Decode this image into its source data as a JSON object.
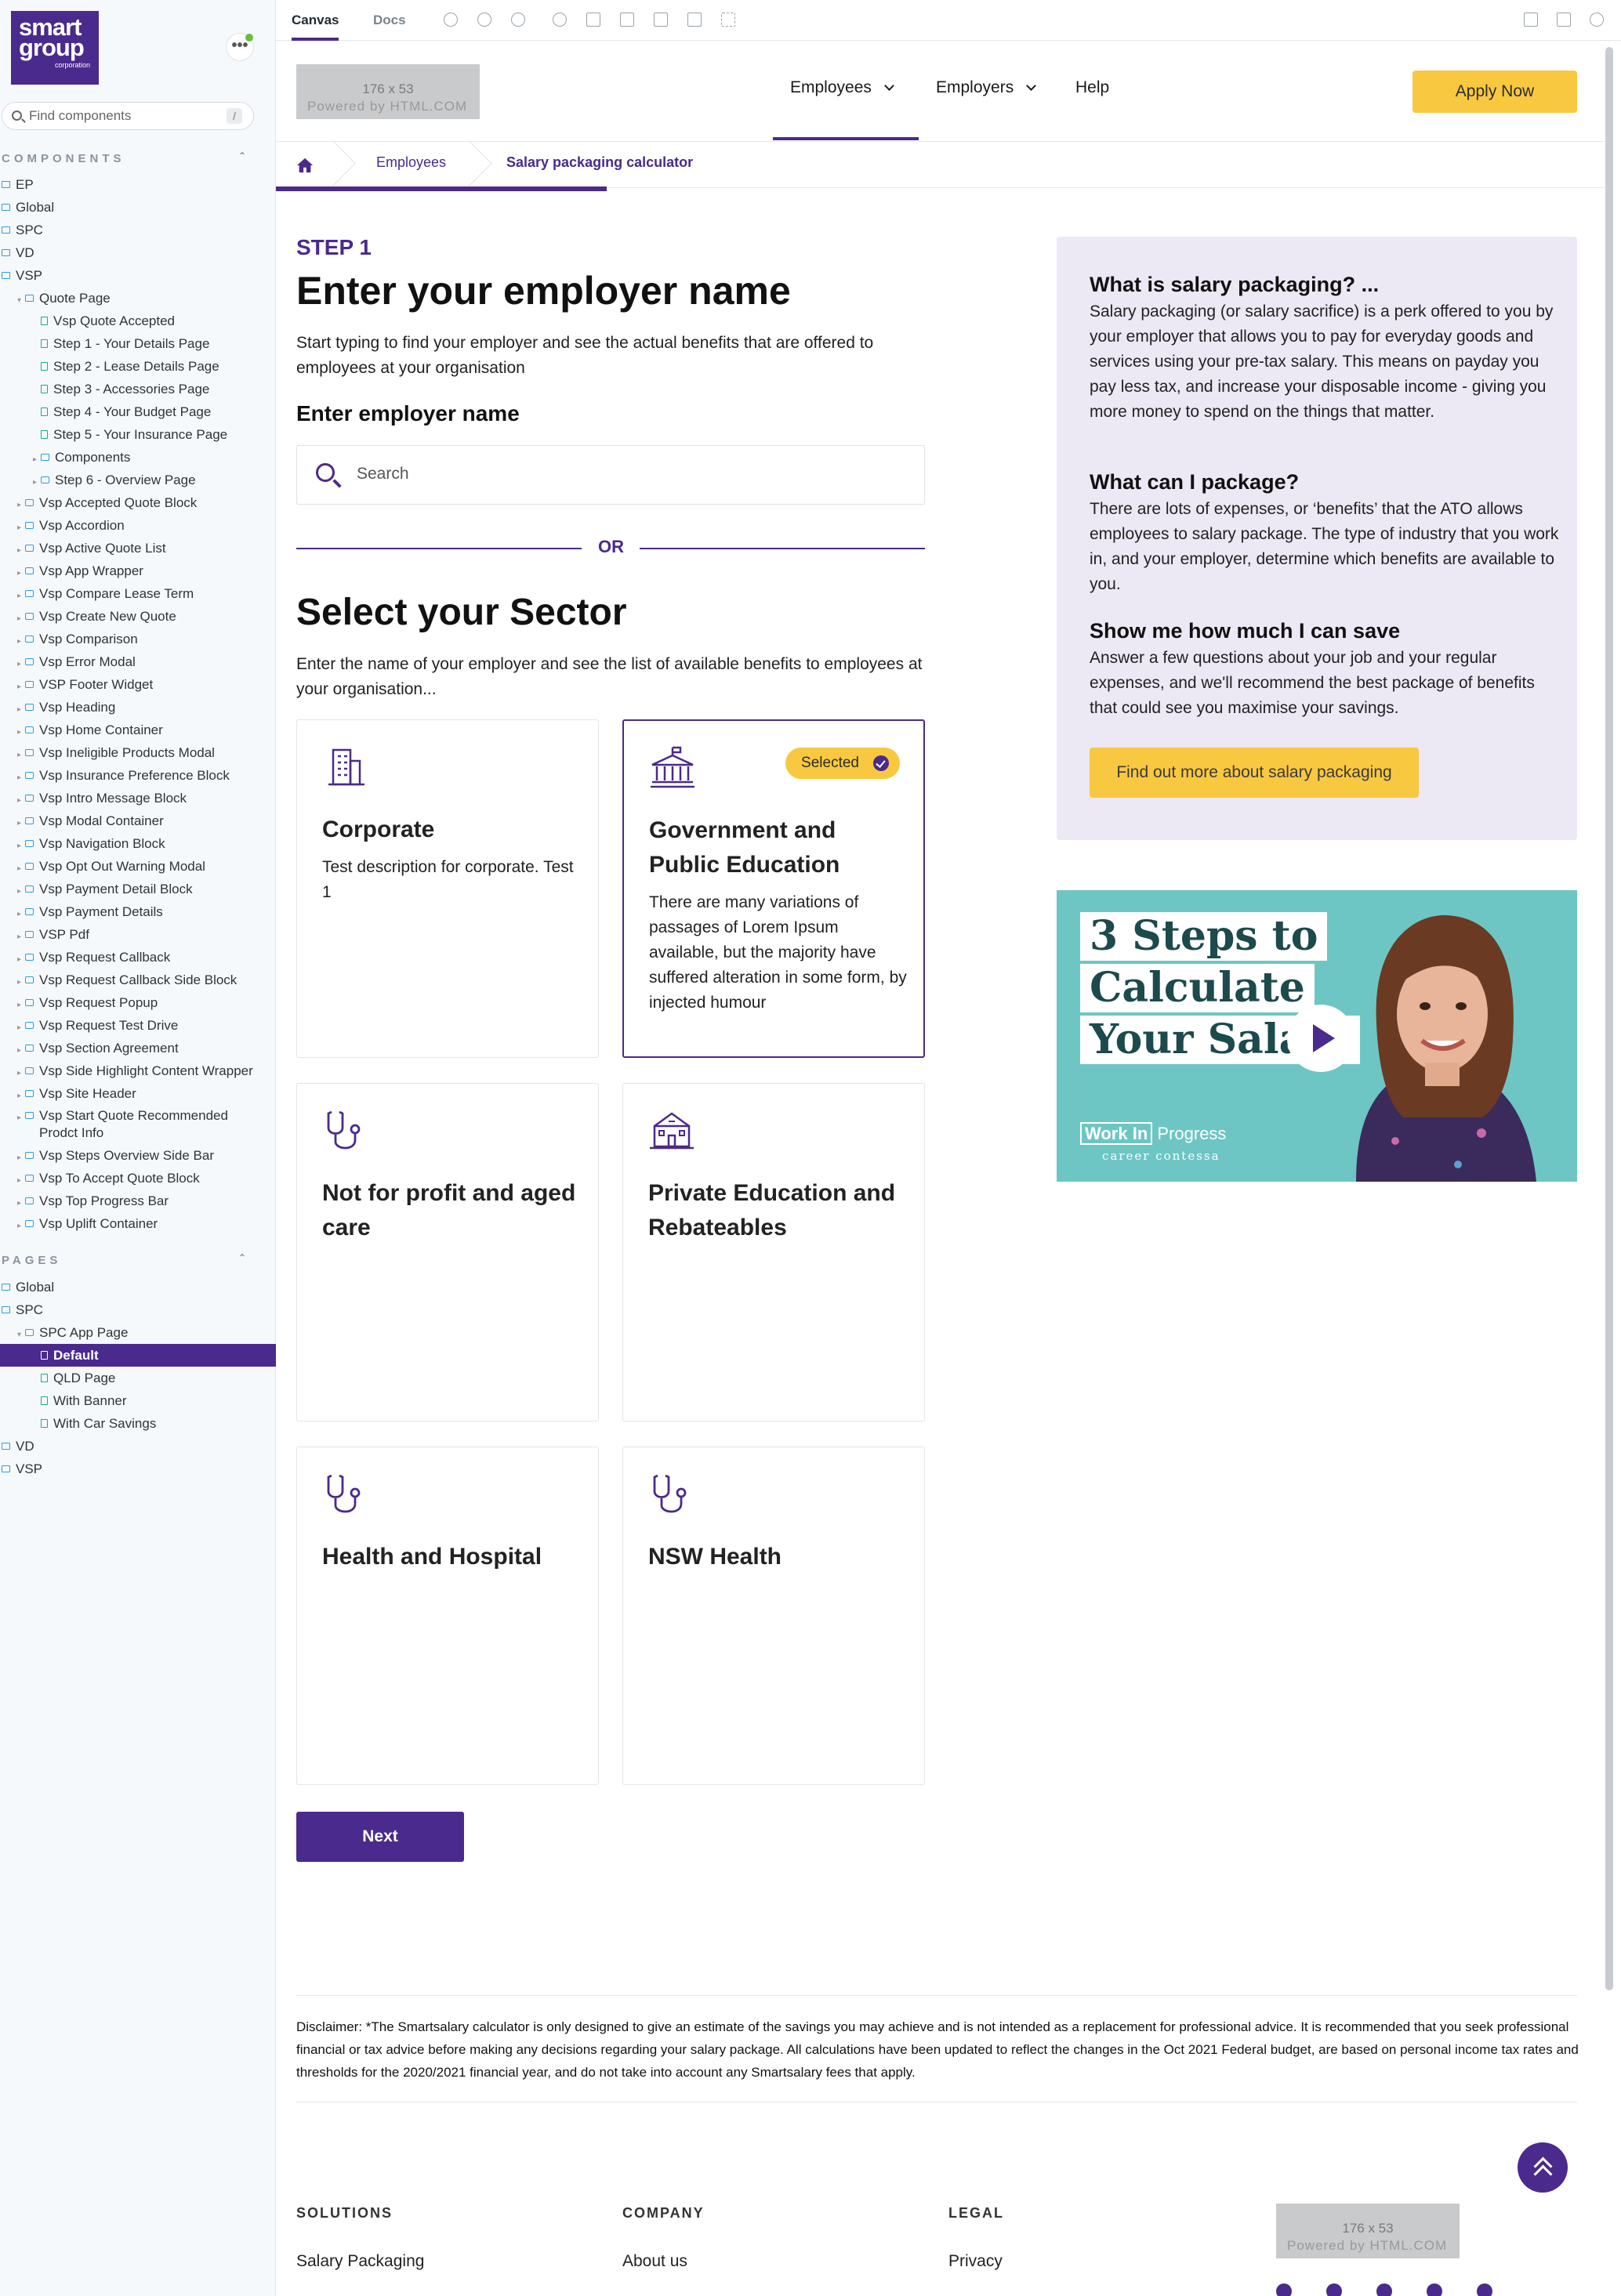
{
  "sidebar": {
    "logo": {
      "line1": "smart",
      "line2": "group",
      "line3": "corporation"
    },
    "menu_label": "•••",
    "search": {
      "placeholder": "Find components",
      "shortcut": "/"
    },
    "components_heading": "COMPONENTS",
    "pages_heading": "PAGES",
    "collapse_icon": "⌃⌄",
    "components": [
      {
        "label": "EP",
        "kind": "folder",
        "depth": 0
      },
      {
        "label": "Global",
        "kind": "folder",
        "depth": 0
      },
      {
        "label": "SPC",
        "kind": "folder",
        "depth": 0
      },
      {
        "label": "VD",
        "kind": "folder",
        "depth": 0
      },
      {
        "label": "VSP",
        "kind": "folder",
        "depth": 0,
        "expanded": true
      },
      {
        "label": "Quote Page",
        "kind": "folder",
        "depth": 1,
        "expanded": true
      },
      {
        "label": "Vsp Quote Accepted",
        "kind": "story",
        "depth": 2
      },
      {
        "label": "Step 1 - Your Details Page",
        "kind": "story",
        "depth": 2
      },
      {
        "label": "Step 2 - Lease Details Page",
        "kind": "story",
        "depth": 2
      },
      {
        "label": "Step 3 - Accessories Page",
        "kind": "story",
        "depth": 2
      },
      {
        "label": "Step 4 - Your Budget Page",
        "kind": "story",
        "depth": 2
      },
      {
        "label": "Step 5 - Your Insurance Page",
        "kind": "story",
        "depth": 2
      },
      {
        "label": "Components",
        "kind": "folder",
        "depth": 2
      },
      {
        "label": "Step 6 - Overview Page",
        "kind": "component",
        "depth": 2
      },
      {
        "label": "Vsp Accepted Quote Block",
        "kind": "component",
        "depth": 1
      },
      {
        "label": "Vsp Accordion",
        "kind": "component",
        "depth": 1
      },
      {
        "label": "Vsp Active Quote List",
        "kind": "component",
        "depth": 1
      },
      {
        "label": "Vsp App Wrapper",
        "kind": "component",
        "depth": 1
      },
      {
        "label": "Vsp Compare Lease Term",
        "kind": "component",
        "depth": 1
      },
      {
        "label": "Vsp Create New Quote",
        "kind": "component",
        "depth": 1
      },
      {
        "label": "Vsp Comparison",
        "kind": "component",
        "depth": 1
      },
      {
        "label": "Vsp Error Modal",
        "kind": "component",
        "depth": 1
      },
      {
        "label": "VSP Footer Widget",
        "kind": "component",
        "depth": 1
      },
      {
        "label": "Vsp Heading",
        "kind": "component",
        "depth": 1
      },
      {
        "label": "Vsp Home Container",
        "kind": "component",
        "depth": 1
      },
      {
        "label": "Vsp Ineligible Products Modal",
        "kind": "component",
        "depth": 1
      },
      {
        "label": "Vsp Insurance Preference Block",
        "kind": "component",
        "depth": 1
      },
      {
        "label": "Vsp Intro Message Block",
        "kind": "component",
        "depth": 1
      },
      {
        "label": "Vsp Modal Container",
        "kind": "component",
        "depth": 1
      },
      {
        "label": "Vsp Navigation Block",
        "kind": "component",
        "depth": 1
      },
      {
        "label": "Vsp Opt Out Warning Modal",
        "kind": "component",
        "depth": 1
      },
      {
        "label": "Vsp Payment Detail Block",
        "kind": "component",
        "depth": 1
      },
      {
        "label": "Vsp Payment Details",
        "kind": "component",
        "depth": 1
      },
      {
        "label": "VSP Pdf",
        "kind": "component",
        "depth": 1
      },
      {
        "label": "Vsp Request Callback",
        "kind": "component",
        "depth": 1
      },
      {
        "label": "Vsp Request Callback Side Block",
        "kind": "component",
        "depth": 1
      },
      {
        "label": "Vsp Request Popup",
        "kind": "component",
        "depth": 1
      },
      {
        "label": "Vsp Request Test Drive",
        "kind": "component",
        "depth": 1
      },
      {
        "label": "Vsp Section Agreement",
        "kind": "component",
        "depth": 1
      },
      {
        "label": "Vsp Side Highlight Content Wrapper",
        "kind": "component",
        "depth": 1
      },
      {
        "label": "Vsp Site Header",
        "kind": "component",
        "depth": 1
      },
      {
        "label": "Vsp Start Quote Recommended Prodct Info",
        "kind": "component",
        "depth": 1,
        "two_line": true
      },
      {
        "label": "Vsp Steps Overview Side Bar",
        "kind": "component",
        "depth": 1
      },
      {
        "label": "Vsp To Accept Quote Block",
        "kind": "component",
        "depth": 1
      },
      {
        "label": "Vsp Top Progress Bar",
        "kind": "component",
        "depth": 1
      },
      {
        "label": "Vsp Uplift Container",
        "kind": "component",
        "depth": 1
      }
    ],
    "pages": [
      {
        "label": "Global",
        "kind": "folder",
        "depth": 0
      },
      {
        "label": "SPC",
        "kind": "folder",
        "depth": 0,
        "expanded": true
      },
      {
        "label": "SPC App Page",
        "kind": "component",
        "depth": 1,
        "expanded": true
      },
      {
        "label": "Default",
        "kind": "story",
        "depth": 2,
        "selected": true
      },
      {
        "label": "QLD Page",
        "kind": "story",
        "depth": 2
      },
      {
        "label": "With Banner",
        "kind": "story",
        "depth": 2
      },
      {
        "label": "With Car Savings",
        "kind": "story",
        "depth": 2
      },
      {
        "label": "VD",
        "kind": "folder",
        "depth": 0
      },
      {
        "label": "VSP",
        "kind": "folder",
        "depth": 0
      }
    ]
  },
  "toolbar": {
    "tabs": [
      {
        "label": "Canvas",
        "active": true
      },
      {
        "label": "Docs",
        "active": false
      }
    ],
    "tool_icons": [
      "zoom-in-icon",
      "zoom-out-icon",
      "zoom-reset-icon",
      "accessibility-icon",
      "image-icon",
      "grid-icon",
      "background-icon",
      "viewport-icon",
      "outline-icon"
    ],
    "right_icons": [
      "fullscreen-icon",
      "open-new-tab-icon",
      "copy-link-icon"
    ]
  },
  "header": {
    "logo_placeholder": {
      "dims": "176 x 53",
      "caption": "Powered by HTML.COM"
    },
    "nav": [
      {
        "label": "Employees",
        "has_dropdown": true,
        "active": true
      },
      {
        "label": "Employers",
        "has_dropdown": true
      },
      {
        "label": "Help",
        "has_dropdown": false
      }
    ],
    "cta": "Apply Now"
  },
  "breadcrumb": {
    "items": [
      "Employees",
      "Salary packaging calculator"
    ]
  },
  "main": {
    "step_label": "STEP 1",
    "title": "Enter your employer name",
    "intro": "Start typing to find your employer and see the actual benefits that are offered to employees at your organisation",
    "field_label": "Enter employer name",
    "search_placeholder": "Search",
    "or_text": "OR",
    "sector_title": "Select your Sector",
    "sector_intro": "Enter the name of your employer and see the list of available benefits to employees at your organisation...",
    "selected_badge": "Selected",
    "sectors": [
      {
        "title": "Corporate",
        "desc": "Test description for corporate. Test 1",
        "icon": "office-building-icon",
        "selected": false
      },
      {
        "title": "Government and Public Education",
        "desc": "There are many variations of passages of Lorem Ipsum available, but the majority have suffered alteration in some form, by injected humour",
        "icon": "government-building-icon",
        "selected": true
      },
      {
        "title": "Not for profit and aged care",
        "desc": "",
        "icon": "stethoscope-icon",
        "selected": false
      },
      {
        "title": "Private Education and Rebateables",
        "desc": "",
        "icon": "school-building-icon",
        "selected": false
      },
      {
        "title": "Health and Hospital",
        "desc": "",
        "icon": "stethoscope-icon",
        "selected": false
      },
      {
        "title": "NSW Health",
        "desc": "",
        "icon": "stethoscope-icon",
        "selected": false
      }
    ],
    "next": "Next"
  },
  "aside": {
    "sections": [
      {
        "heading": "What is salary packaging? ...",
        "body": "Salary packaging (or salary sacrifice) is a perk offered to you by your employer that allows you to pay for everyday goods and services using your pre-tax salary. This means on payday you pay less tax, and increase your disposable income - giving you more money to spend on the things that matter."
      },
      {
        "heading": "What can I package?",
        "body": "There are lots of expenses, or ‘benefits’ that the ATO allows employees to salary package. The type of industry that you work in, and your employer, determine which benefits are available to you."
      },
      {
        "heading": "Show me how much I can save",
        "body": "Answer a few questions about your job and your regular expenses, and we'll recommend the best package of benefits that could see you maximise your savings."
      }
    ],
    "button": "Find out more about salary packaging",
    "video": {
      "title_lines": [
        "3 Steps to",
        "Calculate",
        "Your Salary"
      ],
      "brand_a": "Work In",
      "brand_b": "Progress",
      "brand_sub": "career contessa"
    }
  },
  "disclaimer": "Disclaimer: *The Smartsalary calculator is only designed to give an estimate of the savings you may achieve and is not intended as a replacement for professional advice. It is recommended that you seek professional financial or tax advice before making any decisions regarding your salary package. All calculations have been updated to reflect the changes in the Oct 2021 Federal budget, are based on personal income tax rates and thresholds for the 2020/2021 financial year, and do not take into account any Smartsalary fees that apply.",
  "footer": {
    "columns": [
      {
        "heading": "SOLUTIONS",
        "link": "Salary Packaging"
      },
      {
        "heading": "COMPANY",
        "link": "About us"
      },
      {
        "heading": "LEGAL",
        "link": "Privacy"
      }
    ],
    "logo_placeholder": {
      "dims": "176 x 53",
      "caption": "Powered by HTML.COM"
    }
  },
  "colors": {
    "brand_purple": "#4a2a8c",
    "accent_yellow": "#f8c840",
    "panel_lavender": "#ece8f4",
    "video_teal": "#6dc6c4"
  }
}
